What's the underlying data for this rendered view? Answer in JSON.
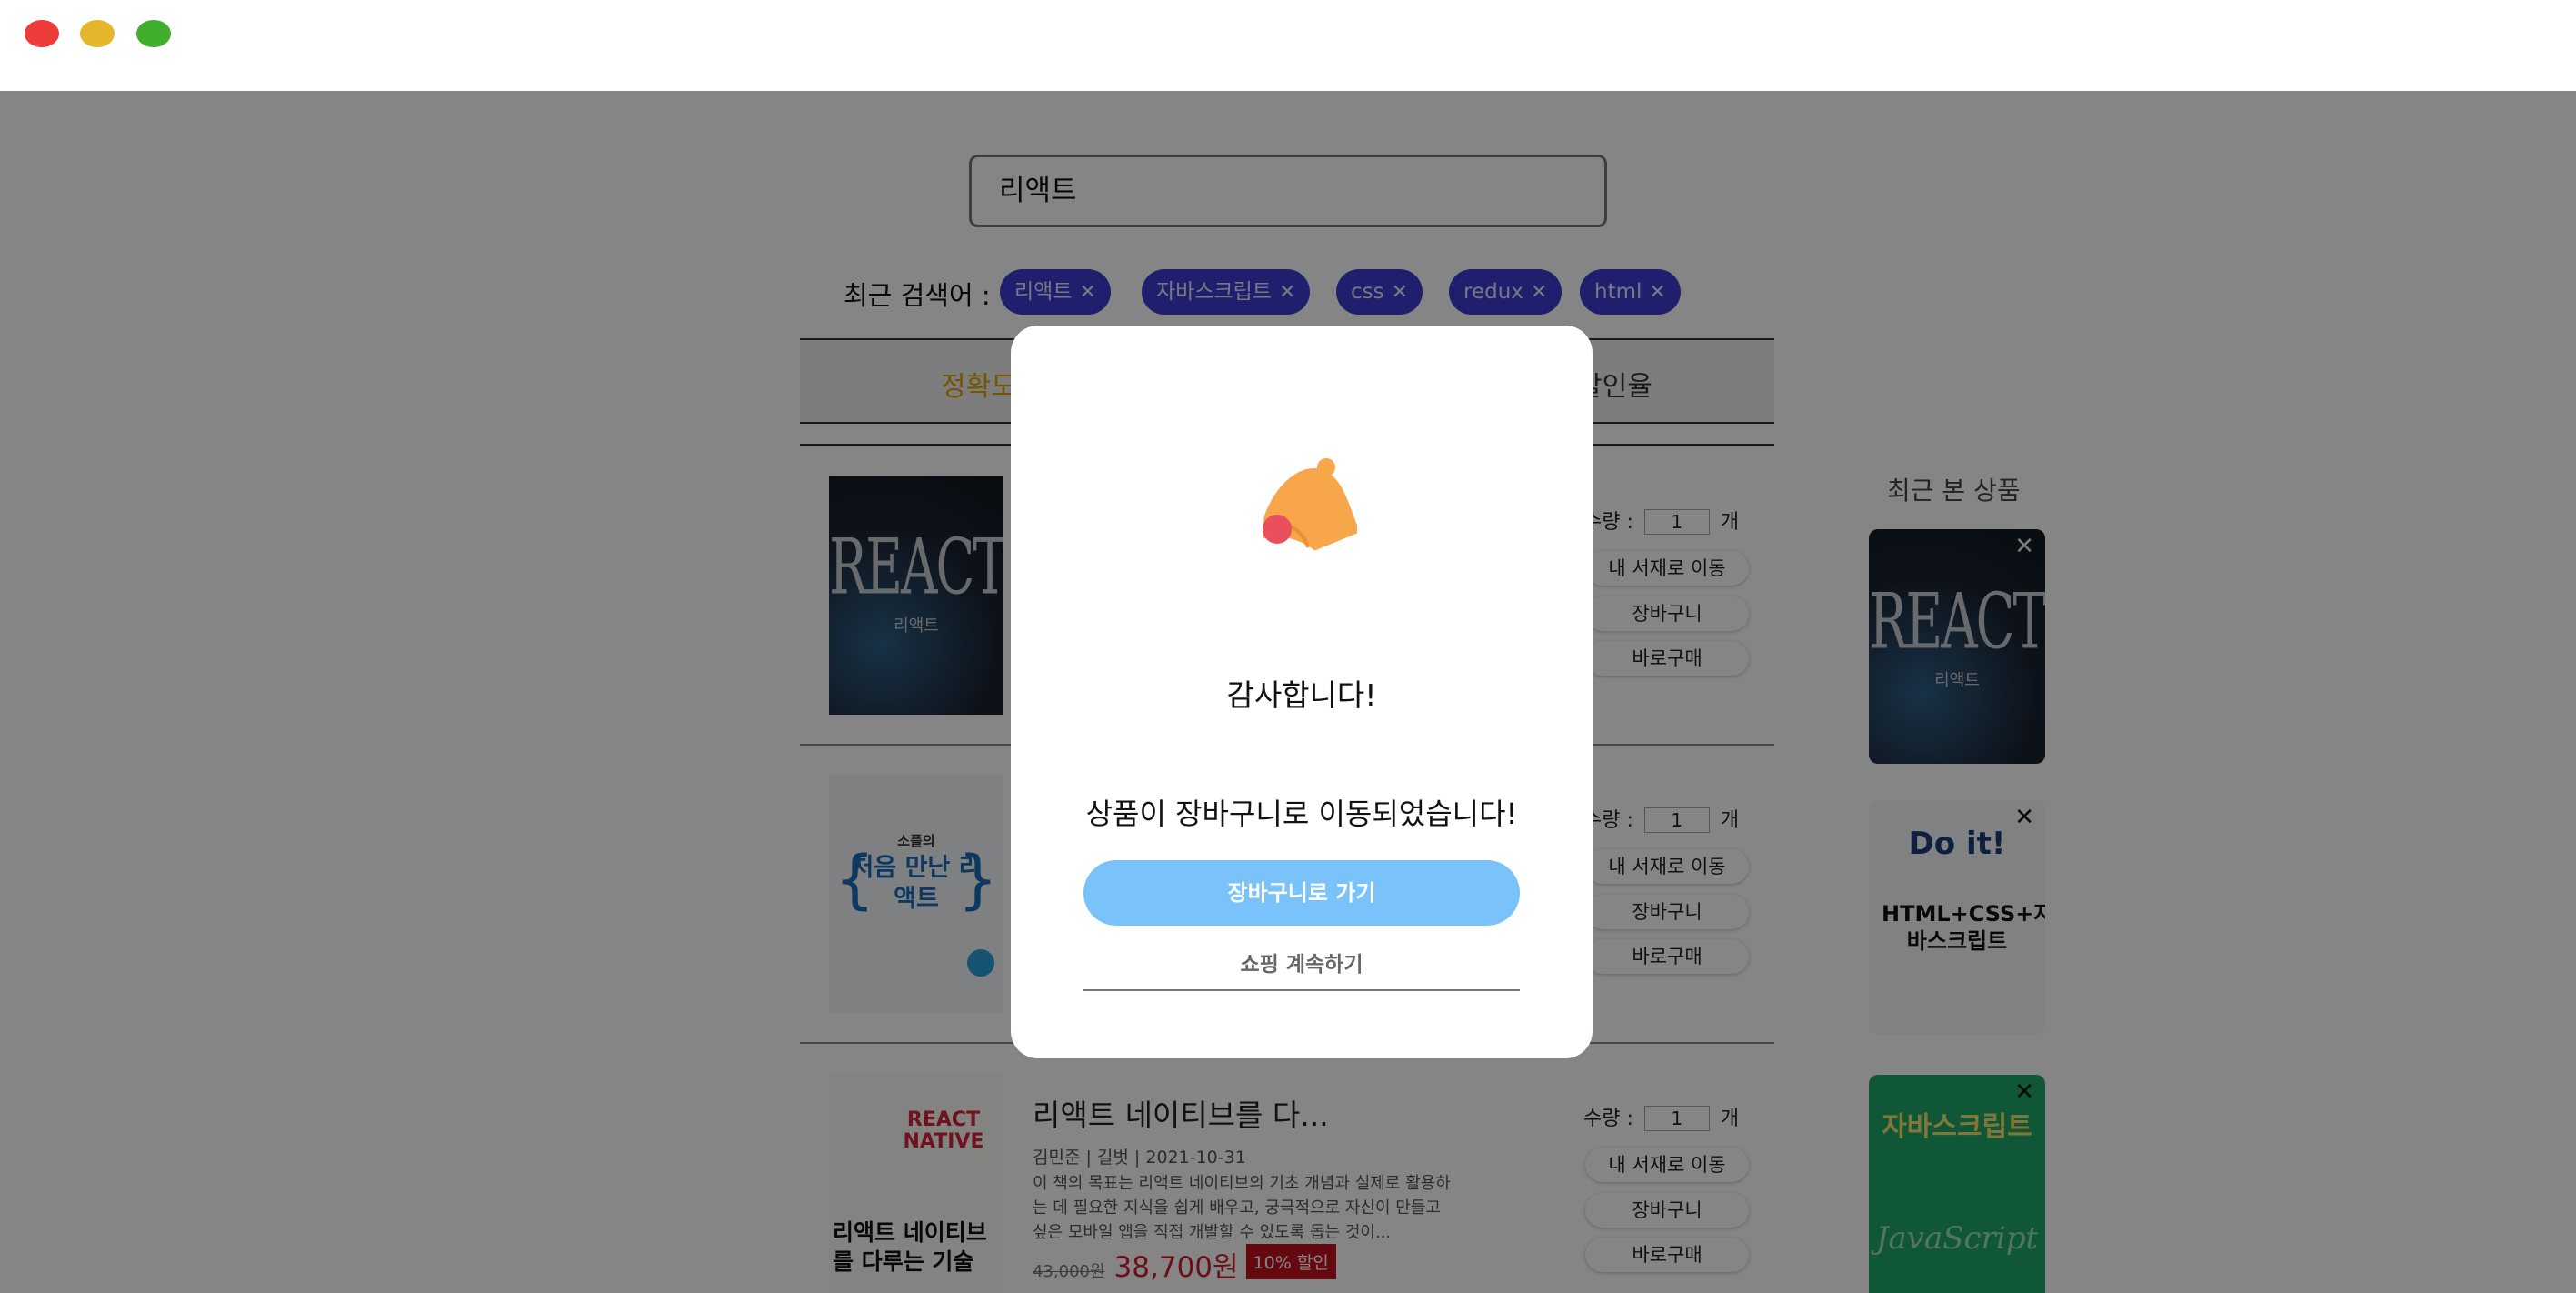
{
  "window": {
    "controls": [
      "close",
      "minimize",
      "maximize"
    ]
  },
  "search": {
    "value": "리액트"
  },
  "recent_searches": {
    "label": "최근 검색어 :",
    "tags": [
      "리액트",
      "자바스크립트",
      "css",
      "redux",
      "html"
    ],
    "remove_glyph": "✕"
  },
  "tabs": [
    {
      "label": "정확도순",
      "active": true
    },
    {
      "label": "할인율",
      "active": false
    }
  ],
  "products": [
    {
      "cover_text": "REACT",
      "cover_sub": "리액트",
      "quantity": "1",
      "qty_label": "수량 :",
      "qty_unit": "개",
      "btn_shelf": "내 서재로 이동",
      "btn_cart": "장바구니",
      "btn_buy": "바로구매"
    },
    {
      "cover_text": "처음 만난 리액트",
      "cover_sub": "소플의",
      "quantity": "1",
      "qty_label": "수량 :",
      "qty_unit": "개",
      "btn_shelf": "내 서재로 이동",
      "btn_cart": "장바구니",
      "btn_buy": "바로구매"
    },
    {
      "title": "리액트 네이티브를 다...",
      "meta": "김민준 |  길벗 |  2021-10-31",
      "description": "이 책의 목표는 리액트 네이티브의 기초 개념과 실제로 활용하는 데 필요한 지식을 쉽게 배우고, 궁극적으로 자신이 만들고 싶은 모바일 앱을 직접 개발할 수 있도록 돕는 것이...",
      "old_price": "43,000원",
      "price": "38,700원",
      "discount": "10% 할인",
      "cover_text": "리액트 네이티브를 다루는 기술",
      "cover_sub": "REACT NATIVE",
      "quantity": "1",
      "qty_label": "수량 :",
      "qty_unit": "개",
      "btn_shelf": "내 서재로 이동",
      "btn_cart": "장바구니",
      "btn_buy": "바로구매"
    }
  ],
  "recently_viewed": {
    "title": "최근 본 상품",
    "close_glyph": "✕",
    "items": [
      {
        "cover_text": "REACT",
        "cover_sub": "리액트"
      },
      {
        "cover_text": "HTML+CSS+자바스크립트",
        "cover_sub": "Do it!"
      },
      {
        "cover_text": "자바스크립트",
        "cover_sub": "JavaScript"
      }
    ]
  },
  "modal": {
    "icon": "bell-icon",
    "title": "감사합니다!",
    "message": "상품이 장바구니로 이동되었습니다!",
    "primary_button": "장바구니로 가기",
    "secondary_button": "쇼핑 계속하기"
  },
  "colors": {
    "tag_bg": "#3d3dd4",
    "primary_button": "#79c3fa",
    "price_red": "#d21c2c",
    "active_tab": "#e0a600",
    "bell": "#f7a74a"
  }
}
